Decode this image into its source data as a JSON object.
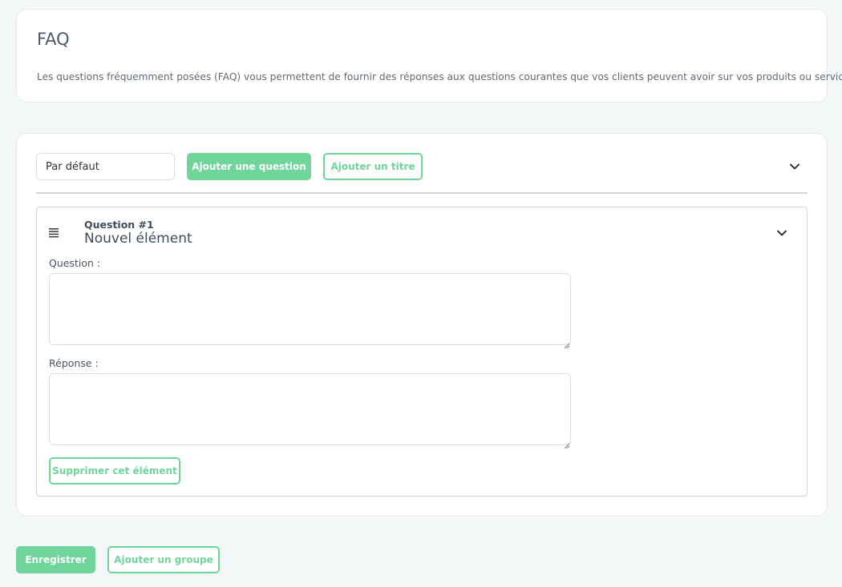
{
  "intro": {
    "title": "FAQ",
    "description": "Les questions fréquemment posées (FAQ) vous permettent de fournir des réponses aux questions courantes que vos clients peuvent avoir sur vos produits ou services."
  },
  "group": {
    "name_value": "Par défaut",
    "add_question_label": "Ajouter une question",
    "add_title_label": "Ajouter un titre",
    "items": [
      {
        "number_label": "Question #1",
        "title": "Nouvel élément",
        "question_label": "Question :",
        "question_value": "",
        "answer_label": "Réponse :",
        "answer_value": "",
        "delete_label": "Supprimer cet élément"
      }
    ]
  },
  "footer": {
    "save_label": "Enregistrer",
    "add_group_label": "Ajouter un groupe"
  },
  "colors": {
    "accent": "#6fd59a",
    "background": "#f4f7f7"
  },
  "icons": {
    "collapse": "chevron-down-icon",
    "drag": "drag-handle-icon"
  }
}
